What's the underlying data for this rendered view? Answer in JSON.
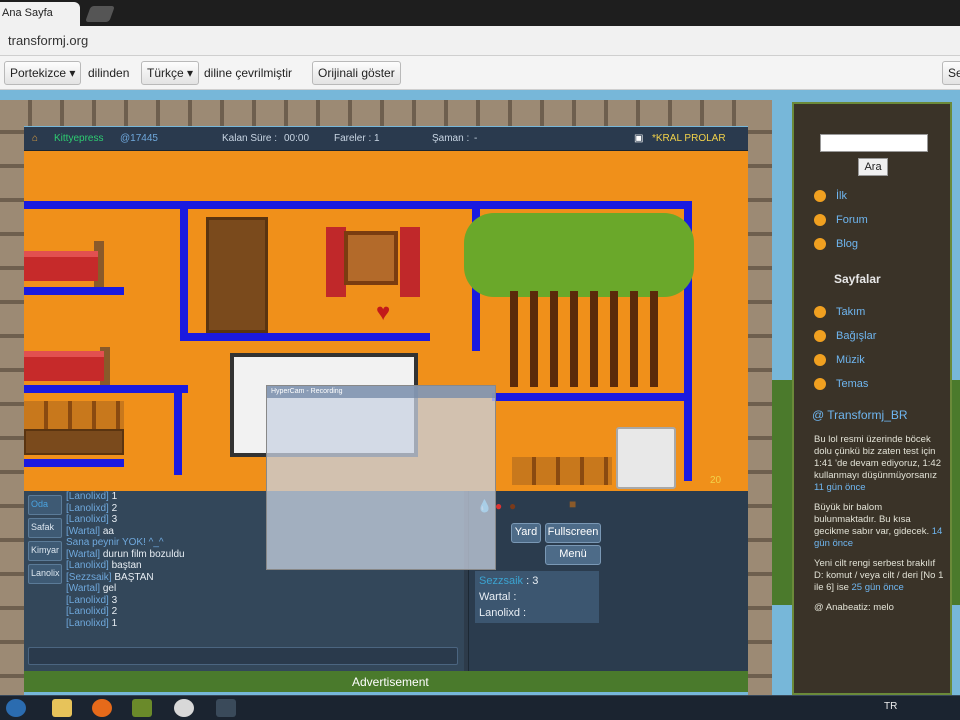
{
  "browser": {
    "tab_title": "Ana Sayfa",
    "url": "transformj.org"
  },
  "translate_bar": {
    "from_lang": "Portekizce",
    "from_suffix": "dilinden",
    "to_lang": "Türkçe",
    "to_suffix": "diline çevrilmiştir",
    "original_button": "Orijinali göster",
    "settings_button": "Se"
  },
  "game_status": {
    "player_name": "Kittyepress",
    "player_tag": "@17445",
    "time_label": "Kalan Süre :",
    "time_value": "00:00",
    "mice_label": "Fareler :",
    "mice_value": "1",
    "shaman_label": "Şaman :",
    "shaman_value": "-",
    "room_name": "*KRAL PROLAR"
  },
  "chat": {
    "tabs": [
      "Oda",
      "Safak",
      "Kimyar",
      "Lanolix"
    ],
    "lines": [
      {
        "name": "[Lanolixd]",
        "text": "1"
      },
      {
        "name": "[Lanolixd]",
        "text": "2"
      },
      {
        "name": "[Lanolixd]",
        "text": "3"
      },
      {
        "name": "[Wartal]",
        "text": "aa"
      },
      {
        "name": "",
        "text": "Sana peynir YOK! ^_^",
        "system": true
      },
      {
        "name": "[Wartal]",
        "text": "durun film bozuldu"
      },
      {
        "name": "[Lanolixd]",
        "text": "baştan"
      },
      {
        "name": "[Sezzsaik]",
        "text": "BAŞTAN"
      },
      {
        "name": "[Wartal]",
        "text": "gel"
      },
      {
        "name": "[Lanolixd]",
        "text": "3"
      },
      {
        "name": "[Lanolixd]",
        "text": "2"
      },
      {
        "name": "[Lanolixd]",
        "text": "1"
      }
    ]
  },
  "right_panel": {
    "yardim_button": "Yard",
    "fullscreen_button": "Fullscreen",
    "menu_button": "Menü",
    "players": [
      {
        "name": "Sezzsaik",
        "score": "3"
      },
      {
        "name": "Wartal",
        "score": ""
      },
      {
        "name": "Lanolixd",
        "score": ""
      }
    ],
    "mouse_counter": "20"
  },
  "overlay": {
    "title": "HyperCam - Recording"
  },
  "advertisement": "Advertisement",
  "sidebar": {
    "search_button": "Ara",
    "links": [
      "İlk",
      "Forum",
      "Blog"
    ],
    "pages_heading": "Sayfalar",
    "pages": [
      "Takım",
      "Bağışlar",
      "Müzik",
      "Temas"
    ],
    "feed_title": "@ Transformj_BR",
    "feed_items": [
      {
        "text": "Bu lol resmi üzerinde böcek dolu çünkü biz zaten test için 1:41 'de devam ediyoruz, 1:42 kullanmayı düşünmüyorsanız",
        "ago": "11 gün önce"
      },
      {
        "text": "Büyük bir balom bulunmaktadır. Bu kısa gecikme sabır var, gidecek.",
        "ago": "14 gün önce"
      },
      {
        "text": "Yeni cilt rengi serbest brakılıf D: komut / veya cilt / deri [No 1 ile 6] ise",
        "ago": "25 gün önce"
      },
      {
        "text": "@ Anabeatiz: melo",
        "ago": ""
      }
    ]
  },
  "taskbar": {
    "lang": "TR"
  }
}
